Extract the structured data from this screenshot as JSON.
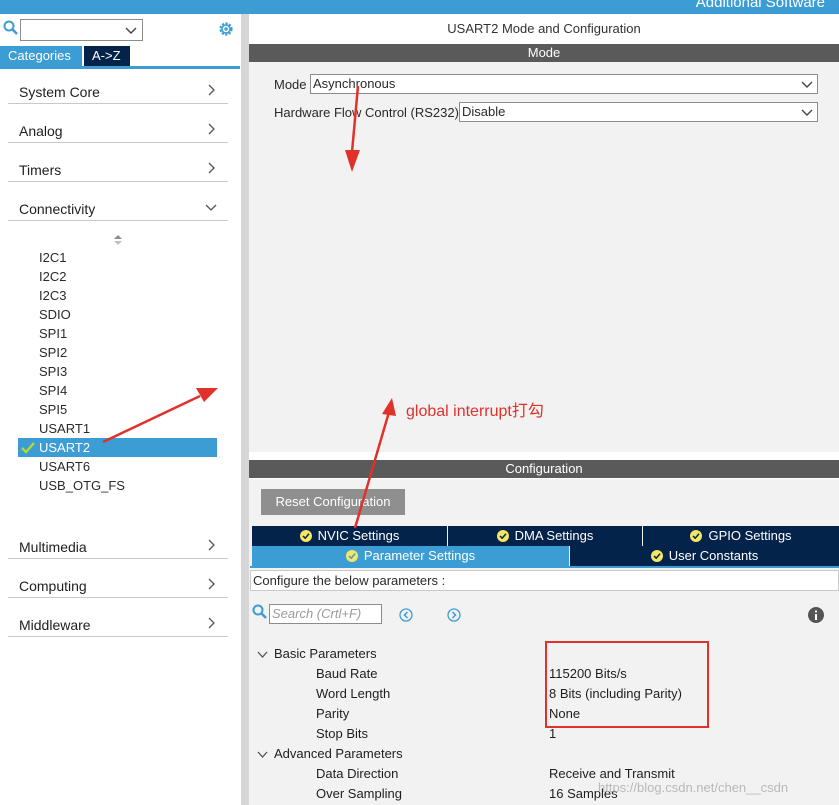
{
  "header": {
    "additional_software": "Additional Software"
  },
  "left": {
    "tabs": {
      "categories": "Categories",
      "az": "A->Z"
    },
    "categories": [
      {
        "label": "System Core"
      },
      {
        "label": "Analog"
      },
      {
        "label": "Timers"
      },
      {
        "label": "Connectivity"
      }
    ],
    "categories_bottom": [
      {
        "label": "Multimedia"
      },
      {
        "label": "Computing"
      },
      {
        "label": "Middleware"
      }
    ],
    "peripherals": [
      "I2C1",
      "I2C2",
      "I2C3",
      "SDIO",
      "SPI1",
      "SPI2",
      "SPI3",
      "SPI4",
      "SPI5",
      "USART1",
      "USART2",
      "USART6",
      "USB_OTG_FS"
    ],
    "selected": "USART2"
  },
  "right": {
    "title": "USART2 Mode and Configuration",
    "mode_bar": "Mode",
    "mode": {
      "label": "Mode",
      "value": "Asynchronous"
    },
    "flow": {
      "label": "Hardware Flow Control (RS232)",
      "value": "Disable"
    },
    "config_bar": "Configuration",
    "reset_button": "Reset Configuration",
    "tabs_row1": [
      "NVIC Settings",
      "DMA Settings",
      "GPIO Settings"
    ],
    "tabs_row2": [
      "Parameter Settings",
      "User Constants"
    ],
    "hint": "Configure the below parameters :",
    "search_placeholder": "Search (Crtl+F)",
    "basic": {
      "label": "Basic Parameters",
      "rows": [
        {
          "name": "Baud Rate",
          "value": "115200 Bits/s"
        },
        {
          "name": "Word Length",
          "value": "8 Bits (including Parity)"
        },
        {
          "name": "Parity",
          "value": "None"
        },
        {
          "name": "Stop Bits",
          "value": "1"
        }
      ]
    },
    "advanced": {
      "label": "Advanced Parameters",
      "rows": [
        {
          "name": "Data Direction",
          "value": "Receive and Transmit"
        },
        {
          "name": "Over Sampling",
          "value": "16 Samples"
        }
      ]
    }
  },
  "annotation": "global interrupt打勾",
  "watermark": "https://blog.csdn.net/chen__csdn",
  "colors": {
    "accent": "#3c9dd4",
    "dark_tab": "#03234b",
    "bar": "#5a5a5a",
    "annotation": "#e0312b"
  }
}
